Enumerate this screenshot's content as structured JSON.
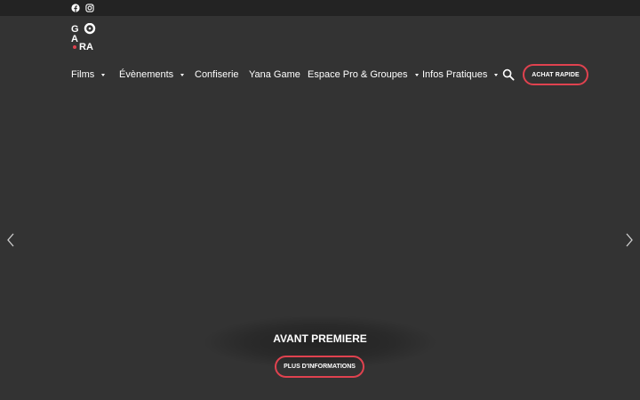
{
  "topbar": {
    "social": [
      "facebook-icon",
      "instagram-icon"
    ]
  },
  "logo": {
    "text": "AGORA",
    "accent_color": "#e0424f"
  },
  "nav": {
    "items": [
      {
        "label": "Films",
        "dropdown": true
      },
      {
        "label": "Évènements",
        "dropdown": true
      },
      {
        "label": "Confiserie",
        "dropdown": false
      },
      {
        "label": "Yana Game",
        "dropdown": false
      },
      {
        "label": "Espace Pro & Groupes",
        "dropdown": true
      },
      {
        "label": "Infos Pratiques",
        "dropdown": true
      }
    ],
    "search_icon": "search-icon",
    "cta_label": "ACHAT RAPIDE"
  },
  "carousel": {
    "prev_icon": "chevron-left-icon",
    "next_icon": "chevron-right-icon",
    "slide_title": "AVANT PREMIERE",
    "slide_button": "PLUS D'INFORMATIONS"
  },
  "colors": {
    "background": "#333333",
    "topbar": "#232323",
    "accent": "#e0424f",
    "text": "#ffffff"
  }
}
